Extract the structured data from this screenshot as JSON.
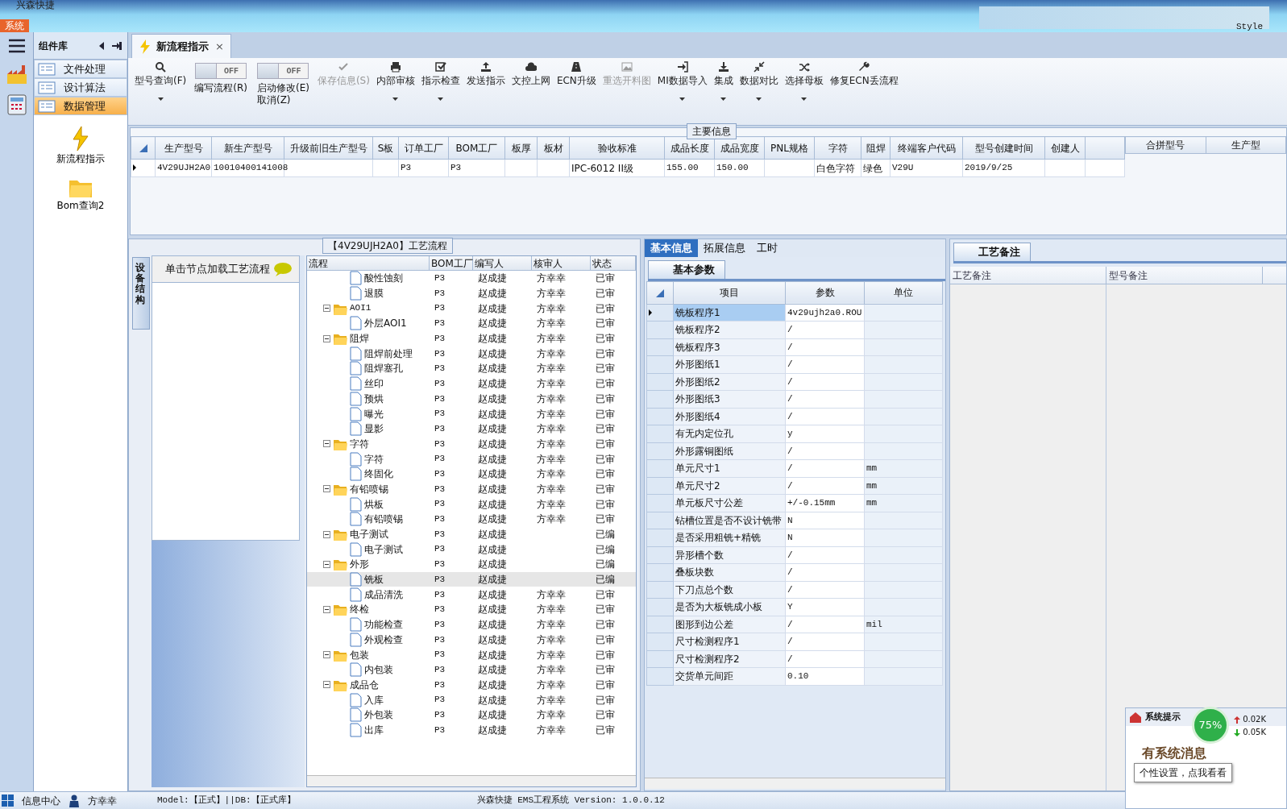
{
  "title_bar": {
    "app_name": "兴森快捷",
    "menu_tab": "系统",
    "style_label": "Style"
  },
  "component_panel": {
    "title": "组件库",
    "items": [
      {
        "label": "文件处理",
        "selected": false
      },
      {
        "label": "设计算法",
        "selected": false
      },
      {
        "label": "数据管理",
        "selected": true
      }
    ],
    "shortcuts": [
      {
        "label": "新流程指示",
        "kind": "flash"
      },
      {
        "label": "Bom查询2",
        "kind": "folder"
      }
    ]
  },
  "doc_tab": {
    "label": "新流程指示",
    "close": "×"
  },
  "toolbar": [
    {
      "kind": "button",
      "label": "型号查询(F)",
      "disabled": false,
      "dropdown": true
    },
    {
      "kind": "toggle",
      "label": "编写流程(R)",
      "switch_text": "OFF",
      "on": false
    },
    {
      "kind": "toggle",
      "label": "启动修改(E)",
      "sublabel": "取消(Z)",
      "switch_text": "OFF",
      "on": false
    },
    {
      "kind": "button",
      "label": "保存信息(S)",
      "disabled": true,
      "dropdown": false
    },
    {
      "kind": "button",
      "label": "内部审核",
      "disabled": false,
      "dropdown": true
    },
    {
      "kind": "button",
      "label": "指示检查",
      "disabled": false,
      "dropdown": true
    },
    {
      "kind": "button",
      "label": "发送指示",
      "disabled": false,
      "dropdown": false
    },
    {
      "kind": "button",
      "label": "文控上网",
      "disabled": false,
      "dropdown": false
    },
    {
      "kind": "button",
      "label": "ECN升级",
      "disabled": false,
      "dropdown": false
    },
    {
      "kind": "button",
      "label": "重选开料图",
      "disabled": true,
      "dropdown": false
    },
    {
      "kind": "button",
      "label": "MI数据导入",
      "disabled": false,
      "dropdown": true
    },
    {
      "kind": "button",
      "label": "集成",
      "disabled": false,
      "dropdown": true
    },
    {
      "kind": "button",
      "label": "数据对比",
      "disabled": false,
      "dropdown": true
    },
    {
      "kind": "button",
      "label": "选择母板",
      "disabled": false,
      "dropdown": true
    },
    {
      "kind": "button",
      "label": "修复ECN丢流程",
      "disabled": false,
      "dropdown": false
    }
  ],
  "main_info": {
    "title": "主要信息",
    "columns": [
      "生产型号",
      "新生产型号",
      "升级前旧生产型号",
      "S板",
      "订单工厂",
      "BOM工厂",
      "板厚",
      "板材",
      "验收标准",
      "成品长度",
      "成品宽度",
      "PNL规格",
      "字符",
      "阻焊",
      "终端客户代码",
      "型号创建时间",
      "创建人"
    ],
    "rows": [
      {
        "selected": true,
        "cells": [
          "4V29UJH2A0",
          "10010400141008",
          "",
          "",
          "P3",
          "P3",
          "",
          "",
          "IPC-6012 II级",
          "155.00",
          "150.00",
          "",
          "白色字符",
          "绿色",
          "V29U",
          "2019/9/25",
          ""
        ]
      }
    ],
    "side_columns": [
      "合拼型号",
      "生产型"
    ]
  },
  "flow_panel": {
    "title": "【4V29UJH2A0】工艺流程",
    "side_tab": "设备结构",
    "hint": "单击节点加载工艺流程",
    "columns": [
      "流程",
      "BOM工厂",
      "编写人",
      "核审人",
      "状态"
    ],
    "nodes": [
      {
        "kind": "file",
        "name": "酸性蚀刻",
        "bom": "P3",
        "writer": "赵成捷",
        "reviewer": "方幸幸",
        "status": "已审",
        "selected": false
      },
      {
        "kind": "file",
        "name": "退膜",
        "bom": "P3",
        "writer": "赵成捷",
        "reviewer": "方幸幸",
        "status": "已审",
        "selected": false
      },
      {
        "kind": "folder",
        "name": "AOI1",
        "bom": "P3",
        "writer": "赵成捷",
        "reviewer": "方幸幸",
        "status": "已审",
        "selected": false,
        "children": [
          {
            "kind": "file",
            "name": "外层AOI1",
            "bom": "P3",
            "writer": "赵成捷",
            "reviewer": "方幸幸",
            "status": "已审",
            "selected": false
          }
        ]
      },
      {
        "kind": "folder",
        "name": "阻焊",
        "bom": "P3",
        "writer": "赵成捷",
        "reviewer": "方幸幸",
        "status": "已审",
        "selected": false,
        "children": [
          {
            "kind": "file",
            "name": "阻焊前处理",
            "bom": "P3",
            "writer": "赵成捷",
            "reviewer": "方幸幸",
            "status": "已审",
            "selected": false
          },
          {
            "kind": "file",
            "name": "阻焊塞孔",
            "bom": "P3",
            "writer": "赵成捷",
            "reviewer": "方幸幸",
            "status": "已审",
            "selected": false
          },
          {
            "kind": "file",
            "name": "丝印",
            "bom": "P3",
            "writer": "赵成捷",
            "reviewer": "方幸幸",
            "status": "已审",
            "selected": false
          },
          {
            "kind": "file",
            "name": "预烘",
            "bom": "P3",
            "writer": "赵成捷",
            "reviewer": "方幸幸",
            "status": "已审",
            "selected": false
          },
          {
            "kind": "file",
            "name": "曝光",
            "bom": "P3",
            "writer": "赵成捷",
            "reviewer": "方幸幸",
            "status": "已审",
            "selected": false
          },
          {
            "kind": "file",
            "name": "显影",
            "bom": "P3",
            "writer": "赵成捷",
            "reviewer": "方幸幸",
            "status": "已审",
            "selected": false
          }
        ]
      },
      {
        "kind": "folder",
        "name": "字符",
        "bom": "P3",
        "writer": "赵成捷",
        "reviewer": "方幸幸",
        "status": "已审",
        "selected": false,
        "children": [
          {
            "kind": "file",
            "name": "字符",
            "bom": "P3",
            "writer": "赵成捷",
            "reviewer": "方幸幸",
            "status": "已审",
            "selected": false
          },
          {
            "kind": "file",
            "name": "终固化",
            "bom": "P3",
            "writer": "赵成捷",
            "reviewer": "方幸幸",
            "status": "已审",
            "selected": false
          }
        ]
      },
      {
        "kind": "folder",
        "name": "有铅喷锡",
        "bom": "P3",
        "writer": "赵成捷",
        "reviewer": "方幸幸",
        "status": "已审",
        "selected": false,
        "children": [
          {
            "kind": "file",
            "name": "烘板",
            "bom": "P3",
            "writer": "赵成捷",
            "reviewer": "方幸幸",
            "status": "已审",
            "selected": false
          },
          {
            "kind": "file",
            "name": "有铅喷锡",
            "bom": "P3",
            "writer": "赵成捷",
            "reviewer": "方幸幸",
            "status": "已审",
            "selected": false
          }
        ]
      },
      {
        "kind": "folder",
        "name": "电子测试",
        "bom": "P3",
        "writer": "赵成捷",
        "status": "已编",
        "selected": false,
        "children": [
          {
            "kind": "file",
            "name": "电子测试",
            "bom": "P3",
            "writer": "赵成捷",
            "status": "已编",
            "selected": false
          }
        ]
      },
      {
        "kind": "folder",
        "name": "外形",
        "bom": "P3",
        "writer": "赵成捷",
        "status": "已编",
        "selected": false,
        "children": [
          {
            "kind": "file",
            "name": "铣板",
            "bom": "P3",
            "writer": "赵成捷",
            "status": "已编",
            "selected": true
          },
          {
            "kind": "file",
            "name": "成品清洗",
            "bom": "P3",
            "writer": "赵成捷",
            "reviewer": "方幸幸",
            "status": "已审",
            "selected": false
          }
        ]
      },
      {
        "kind": "folder",
        "name": "终检",
        "bom": "P3",
        "writer": "赵成捷",
        "reviewer": "方幸幸",
        "status": "已审",
        "selected": false,
        "children": [
          {
            "kind": "file",
            "name": "功能检查",
            "bom": "P3",
            "writer": "赵成捷",
            "reviewer": "方幸幸",
            "status": "已审",
            "selected": false
          },
          {
            "kind": "file",
            "name": "外观检查",
            "bom": "P3",
            "writer": "赵成捷",
            "reviewer": "方幸幸",
            "status": "已审",
            "selected": false
          }
        ]
      },
      {
        "kind": "folder",
        "name": "包装",
        "bom": "P3",
        "writer": "赵成捷",
        "reviewer": "方幸幸",
        "status": "已审",
        "selected": false,
        "children": [
          {
            "kind": "file",
            "name": "内包装",
            "bom": "P3",
            "writer": "赵成捷",
            "reviewer": "方幸幸",
            "status": "已审",
            "selected": false
          }
        ]
      },
      {
        "kind": "folder",
        "name": "成品仓",
        "bom": "P3",
        "writer": "赵成捷",
        "reviewer": "方幸幸",
        "status": "已审",
        "selected": false,
        "children": [
          {
            "kind": "file",
            "name": "入库",
            "bom": "P3",
            "writer": "赵成捷",
            "reviewer": "方幸幸",
            "status": "已审",
            "selected": false
          },
          {
            "kind": "file",
            "name": "外包装",
            "bom": "P3",
            "writer": "赵成捷",
            "reviewer": "方幸幸",
            "status": "已审",
            "selected": false
          },
          {
            "kind": "file",
            "name": "出库",
            "bom": "P3",
            "writer": "赵成捷",
            "reviewer": "方幸幸",
            "status": "已审",
            "selected": false
          }
        ]
      }
    ]
  },
  "detail_tabs": [
    {
      "label": "基本信息",
      "selected": true
    },
    {
      "label": "拓展信息",
      "selected": false
    },
    {
      "label": "工时",
      "selected": false
    }
  ],
  "params": {
    "tab": "基本参数",
    "columns": [
      "项目",
      "参数",
      "单位"
    ],
    "rows": [
      {
        "item": "铣板程序1",
        "value": "4v29ujh2a0.ROU",
        "selected": true
      },
      {
        "item": "铣板程序2",
        "value": "/",
        "selected": false
      },
      {
        "item": "铣板程序3",
        "value": "/",
        "selected": false
      },
      {
        "item": "外形图纸1",
        "value": "/",
        "selected": false
      },
      {
        "item": "外形图纸2",
        "value": "/",
        "selected": false
      },
      {
        "item": "外形图纸3",
        "value": "/",
        "selected": false
      },
      {
        "item": "外形图纸4",
        "value": "/",
        "selected": false
      },
      {
        "item": "有无内定位孔",
        "value": "y",
        "selected": false
      },
      {
        "item": "外形露铜图纸",
        "value": "/",
        "selected": false
      },
      {
        "item": "单元尺寸1",
        "value": "/",
        "unit": "mm",
        "selected": false
      },
      {
        "item": "单元尺寸2",
        "value": "/",
        "unit": "mm",
        "selected": false
      },
      {
        "item": "单元板尺寸公差",
        "value": "+/-0.15mm",
        "unit": "mm",
        "selected": false
      },
      {
        "item": "钻槽位置是否不设计铣带",
        "value": "N",
        "selected": false
      },
      {
        "item": "是否采用粗铣+精铣",
        "value": "N",
        "selected": false
      },
      {
        "item": "异形槽个数",
        "value": "/",
        "selected": false
      },
      {
        "item": "叠板块数",
        "value": "/",
        "selected": false
      },
      {
        "item": "下刀点总个数",
        "value": "/",
        "selected": false
      },
      {
        "item": "是否为大板铣成小板",
        "value": "Y",
        "selected": false
      },
      {
        "item": "图形到边公差",
        "value": "/",
        "unit": "mil",
        "selected": false
      },
      {
        "item": "尺寸检测程序1",
        "value": "/",
        "selected": false
      },
      {
        "item": "尺寸检测程序2",
        "value": "/",
        "selected": false
      },
      {
        "item": "交货单元间距",
        "value": "0.10",
        "selected": false
      }
    ]
  },
  "notes": {
    "tab": "工艺备注",
    "columns": [
      "工艺备注",
      "型号备注"
    ]
  },
  "popup": {
    "title": "系统提示",
    "percent": "75%",
    "up": "0.02K",
    "down": "0.05K",
    "message": "有系统消息",
    "tooltip": "个性设置，点我看看"
  },
  "status_bar": {
    "info_center": "信息中心",
    "user": "方幸幸",
    "model": "Model:【正式】||DB:【正式库】",
    "version": "兴森快捷 EMS工程系统 Version: 1.0.0.12"
  }
}
